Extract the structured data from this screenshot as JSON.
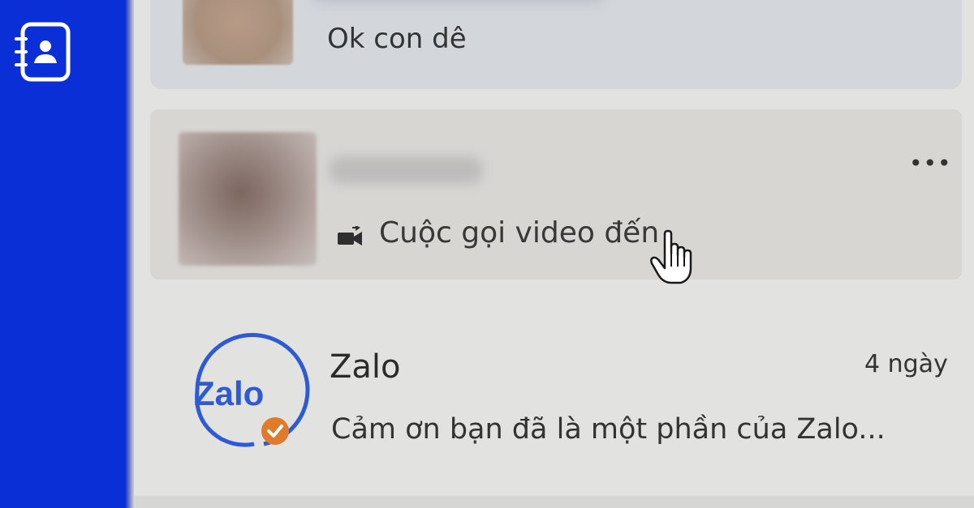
{
  "sidebar": {
    "contacts_icon": "contacts-book-icon"
  },
  "conversations": [
    {
      "avatar": "blurred-avatar",
      "message": "Ok con dê"
    },
    {
      "avatar": "blurred-avatar",
      "message_icon": "video-camera-icon",
      "message": "Cuộc gọi video đến",
      "more_icon": "more-dots-icon"
    },
    {
      "avatar": "zalo-logo",
      "name": "Zalo",
      "time": "4 ngày",
      "message": "Cảm ơn bạn đã là một phần của Zalo...",
      "verified_icon": "verified-badge-icon"
    }
  ],
  "colors": {
    "sidebar": "#0b2fd6",
    "zalo_blue": "#2e5ad4",
    "verified_orange": "#e07b2c"
  },
  "cursor": "hand-pointer-icon"
}
